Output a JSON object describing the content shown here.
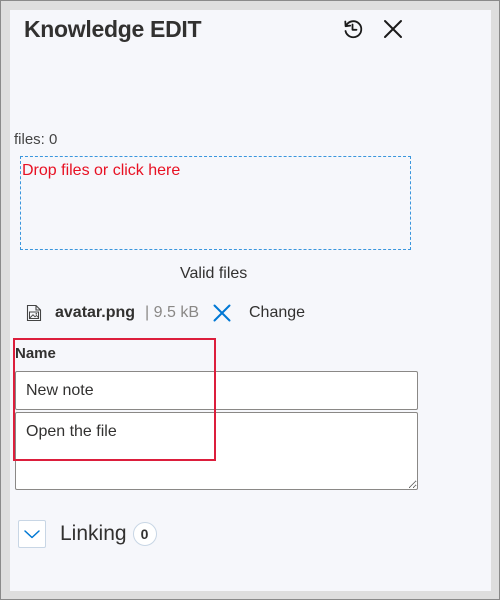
{
  "header": {
    "title": "Knowledge EDIT",
    "history_icon": "history-icon",
    "close_icon": "close-icon"
  },
  "files": {
    "count_label": "files: 0",
    "dropzone_text": "Drop files or click here",
    "valid_files_label": "Valid files",
    "items": [
      {
        "icon": "image-file-icon",
        "name": "avatar.png",
        "size": "| 9.5 kB",
        "remove_icon": "remove-icon",
        "change_label": "Change"
      }
    ]
  },
  "form": {
    "name_label": "Name",
    "name_value": "New note",
    "description_value": "Open the file"
  },
  "linking": {
    "expand_icon": "chevron-down-icon",
    "label": "Linking",
    "count": "0"
  },
  "colors": {
    "accent": "#0078d4",
    "dropzone_text": "#e81123",
    "dropzone_border": "#3a96dd",
    "highlight": "#dc1e3c",
    "panel_bg": "#f6f7fb"
  }
}
